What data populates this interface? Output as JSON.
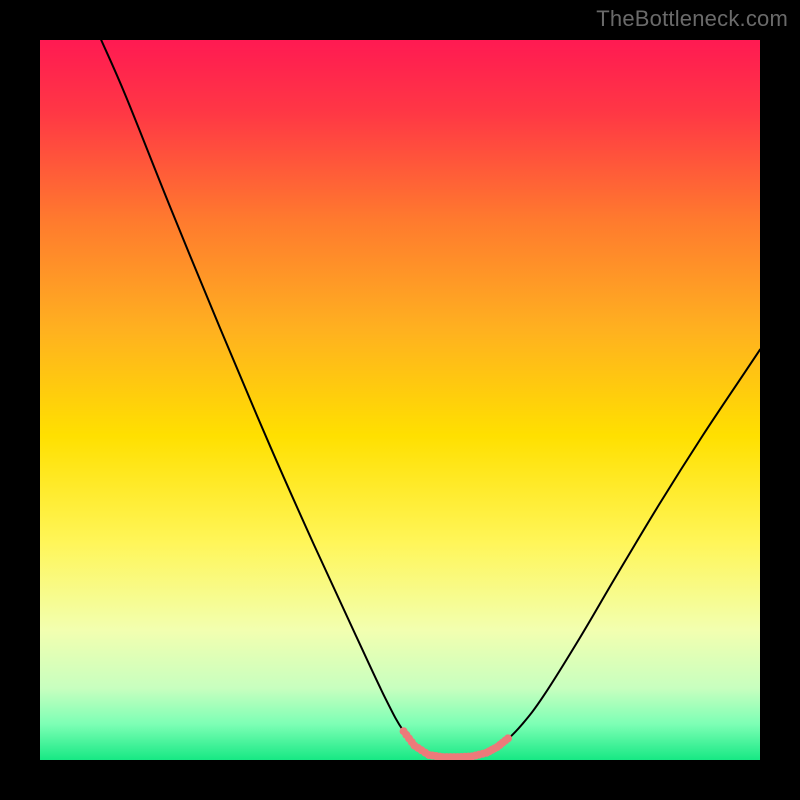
{
  "attribution": "TheBottleneck.com",
  "chart_data": {
    "type": "line",
    "title": "",
    "xlabel": "",
    "ylabel": "",
    "xlim": [
      0,
      100
    ],
    "ylim": [
      0,
      100
    ],
    "grid": false,
    "legend": false,
    "background_gradient": {
      "stops": [
        {
          "pos": 0.0,
          "color": "#ff1a52"
        },
        {
          "pos": 0.1,
          "color": "#ff3745"
        },
        {
          "pos": 0.25,
          "color": "#ff7a2e"
        },
        {
          "pos": 0.4,
          "color": "#ffb020"
        },
        {
          "pos": 0.55,
          "color": "#ffe000"
        },
        {
          "pos": 0.7,
          "color": "#fff65a"
        },
        {
          "pos": 0.82,
          "color": "#f2ffb0"
        },
        {
          "pos": 0.9,
          "color": "#c8ffbf"
        },
        {
          "pos": 0.95,
          "color": "#7dffb5"
        },
        {
          "pos": 1.0,
          "color": "#17e884"
        }
      ]
    },
    "series": [
      {
        "name": "black-curve",
        "color": "#000000",
        "width": 2,
        "points": [
          {
            "x": 8.5,
            "y": 100.0
          },
          {
            "x": 12.0,
            "y": 92.0
          },
          {
            "x": 18.0,
            "y": 77.0
          },
          {
            "x": 25.0,
            "y": 60.0
          },
          {
            "x": 32.0,
            "y": 43.5
          },
          {
            "x": 38.0,
            "y": 30.0
          },
          {
            "x": 44.0,
            "y": 17.0
          },
          {
            "x": 48.0,
            "y": 8.5
          },
          {
            "x": 50.5,
            "y": 4.0
          },
          {
            "x": 53.0,
            "y": 1.3
          },
          {
            "x": 56.0,
            "y": 0.4
          },
          {
            "x": 59.0,
            "y": 0.4
          },
          {
            "x": 62.0,
            "y": 1.0
          },
          {
            "x": 64.5,
            "y": 2.5
          },
          {
            "x": 67.0,
            "y": 5.0
          },
          {
            "x": 70.0,
            "y": 9.0
          },
          {
            "x": 75.0,
            "y": 17.0
          },
          {
            "x": 80.0,
            "y": 25.5
          },
          {
            "x": 86.0,
            "y": 35.5
          },
          {
            "x": 92.0,
            "y": 45.0
          },
          {
            "x": 98.0,
            "y": 54.0
          },
          {
            "x": 100.0,
            "y": 57.0
          }
        ]
      },
      {
        "name": "pink-highlight",
        "color": "#ed7a7a",
        "width": 8,
        "points": [
          {
            "x": 50.5,
            "y": 4.0
          },
          {
            "x": 52.0,
            "y": 2.0
          },
          {
            "x": 54.0,
            "y": 0.7
          },
          {
            "x": 56.0,
            "y": 0.4
          },
          {
            "x": 58.0,
            "y": 0.4
          },
          {
            "x": 60.0,
            "y": 0.5
          },
          {
            "x": 62.0,
            "y": 1.0
          },
          {
            "x": 63.5,
            "y": 1.8
          },
          {
            "x": 65.0,
            "y": 3.0
          }
        ]
      }
    ]
  }
}
